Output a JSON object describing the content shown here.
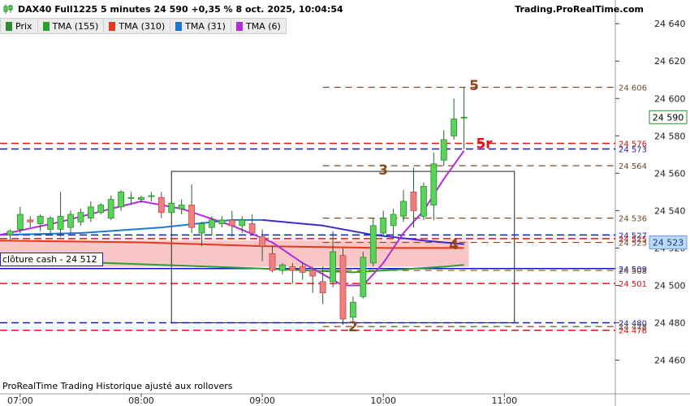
{
  "header": {
    "title": "DAX40 Full1225 5 minutes 24 590 +0,35 % 8 oct. 2025, 10:04:54",
    "site": "Trading.ProRealTime.com"
  },
  "legend": [
    {
      "label": "Prix",
      "color": "#2e8b2e"
    },
    {
      "label": "TMA (155)",
      "color": "#2ca02c"
    },
    {
      "label": "TMA (310)",
      "color": "#e03a1e"
    },
    {
      "label": "TMA (31)",
      "color": "#1f77d4"
    },
    {
      "label": "TMA (6)",
      "color": "#b22cd8"
    }
  ],
  "cash_label": "clôture cash -  24 512",
  "footer_note": "ProRealTime Trading  Historique ajusté aux rollovers",
  "colors": {
    "up": "#59d359",
    "down": "#f08080",
    "brown": "#8b4a1c",
    "red": "#e8121e",
    "blue": "#1414c8",
    "ma155": "#2ca02c",
    "ma310": "#e03a1e",
    "ma31": "#1f77d4",
    "ma6": "#b22cd8",
    "purple": "#3a2ad0",
    "band": "#f7bcbc"
  },
  "chart_data": {
    "type": "candlestick",
    "instrument": "DAX40 Full1225",
    "timeframe": "5 minutes",
    "x_ticks": [
      "07:00",
      "08:00",
      "09:00",
      "10:00",
      "11:00"
    ],
    "y_ticks": [
      "24 640",
      "24 620",
      "24 600",
      "24 580",
      "24 560",
      "24 540",
      "24 520",
      "24 500",
      "24 480",
      "24 460"
    ],
    "ylim": [
      24442,
      24644
    ],
    "xlim": [
      "06:50",
      "11:55"
    ],
    "last_price": "24 590",
    "candles": [
      {
        "t": "06:55",
        "o": 24527,
        "h": 24530,
        "l": 24524,
        "c": 24529
      },
      {
        "t": "07:00",
        "o": 24530,
        "h": 24542,
        "l": 24528,
        "c": 24538
      },
      {
        "t": "07:05",
        "o": 24535,
        "h": 24537,
        "l": 24531,
        "c": 24534
      },
      {
        "t": "07:10",
        "o": 24533,
        "h": 24538,
        "l": 24529,
        "c": 24537
      },
      {
        "t": "07:15",
        "o": 24530,
        "h": 24537,
        "l": 24527,
        "c": 24536
      },
      {
        "t": "07:20",
        "o": 24530,
        "h": 24550,
        "l": 24526,
        "c": 24537
      },
      {
        "t": "07:25",
        "o": 24531,
        "h": 24540,
        "l": 24528,
        "c": 24538
      },
      {
        "t": "07:30",
        "o": 24534,
        "h": 24541,
        "l": 24532,
        "c": 24539
      },
      {
        "t": "07:35",
        "o": 24536,
        "h": 24545,
        "l": 24534,
        "c": 24542
      },
      {
        "t": "07:40",
        "o": 24539,
        "h": 24544,
        "l": 24538,
        "c": 24543
      },
      {
        "t": "07:45",
        "o": 24536,
        "h": 24548,
        "l": 24535,
        "c": 24546
      },
      {
        "t": "07:50",
        "o": 24542,
        "h": 24551,
        "l": 24540,
        "c": 24550
      },
      {
        "t": "07:55",
        "o": 24547,
        "h": 24550,
        "l": 24543,
        "c": 24547
      },
      {
        "t": "08:00",
        "o": 24546,
        "h": 24548,
        "l": 24544,
        "c": 24547
      },
      {
        "t": "08:05",
        "o": 24548,
        "h": 24550,
        "l": 24545,
        "c": 24548
      },
      {
        "t": "08:10",
        "o": 24547,
        "h": 24550,
        "l": 24536,
        "c": 24539
      },
      {
        "t": "08:15",
        "o": 24539,
        "h": 24545,
        "l": 24538,
        "c": 24544
      },
      {
        "t": "08:20",
        "o": 24541,
        "h": 24546,
        "l": 24538,
        "c": 24543
      },
      {
        "t": "08:25",
        "o": 24543,
        "h": 24554,
        "l": 24528,
        "c": 24531
      },
      {
        "t": "08:30",
        "o": 24528,
        "h": 24534,
        "l": 24521,
        "c": 24533
      },
      {
        "t": "08:35",
        "o": 24531,
        "h": 24537,
        "l": 24527,
        "c": 24535
      },
      {
        "t": "08:40",
        "o": 24533,
        "h": 24537,
        "l": 24531,
        "c": 24535
      },
      {
        "t": "08:45",
        "o": 24535,
        "h": 24540,
        "l": 24526,
        "c": 24532
      },
      {
        "t": "08:50",
        "o": 24532,
        "h": 24537,
        "l": 24528,
        "c": 24535
      },
      {
        "t": "08:55",
        "o": 24533,
        "h": 24538,
        "l": 24529,
        "c": 24528
      },
      {
        "t": "09:00",
        "o": 24526,
        "h": 24530,
        "l": 24513,
        "c": 24521
      },
      {
        "t": "09:05",
        "o": 24517,
        "h": 24521,
        "l": 24507,
        "c": 24508
      },
      {
        "t": "09:10",
        "o": 24508,
        "h": 24512,
        "l": 24506,
        "c": 24511
      },
      {
        "t": "09:15",
        "o": 24510,
        "h": 24512,
        "l": 24501,
        "c": 24508
      },
      {
        "t": "09:20",
        "o": 24510,
        "h": 24512,
        "l": 24503,
        "c": 24507
      },
      {
        "t": "09:25",
        "o": 24508,
        "h": 24510,
        "l": 24496,
        "c": 24505
      },
      {
        "t": "09:30",
        "o": 24502,
        "h": 24510,
        "l": 24490,
        "c": 24496
      },
      {
        "t": "09:35",
        "o": 24502,
        "h": 24529,
        "l": 24499,
        "c": 24518
      },
      {
        "t": "09:40",
        "o": 24516,
        "h": 24520,
        "l": 24479,
        "c": 24482
      },
      {
        "t": "09:45",
        "o": 24483,
        "h": 24494,
        "l": 24480,
        "c": 24491
      },
      {
        "t": "09:50",
        "o": 24494,
        "h": 24518,
        "l": 24493,
        "c": 24515
      },
      {
        "t": "09:55",
        "o": 24512,
        "h": 24536,
        "l": 24510,
        "c": 24532
      },
      {
        "t": "10:00",
        "o": 24528,
        "h": 24540,
        "l": 24526,
        "c": 24536
      },
      {
        "t": "10:05",
        "o": 24532,
        "h": 24541,
        "l": 24526,
        "c": 24538
      },
      {
        "t": "10:10",
        "o": 24537,
        "h": 24551,
        "l": 24534,
        "c": 24545
      },
      {
        "t": "10:15",
        "o": 24550,
        "h": 24563,
        "l": 24531,
        "c": 24540
      },
      {
        "t": "10:20",
        "o": 24537,
        "h": 24555,
        "l": 24535,
        "c": 24553
      },
      {
        "t": "10:25",
        "o": 24543,
        "h": 24571,
        "l": 24535,
        "c": 24565
      },
      {
        "t": "10:30",
        "o": 24567,
        "h": 24583,
        "l": 24564,
        "c": 24578
      },
      {
        "t": "10:35",
        "o": 24580,
        "h": 24600,
        "l": 24578,
        "c": 24589
      },
      {
        "t": "10:40",
        "o": 24590,
        "h": 24606,
        "l": 24573,
        "c": 24590
      }
    ],
    "ma_lines": [
      {
        "name": "TMA (155)",
        "color": "#2ca02c",
        "points": [
          [
            "06:50",
            24514
          ],
          [
            "08:10",
            24511
          ],
          [
            "09:00",
            24509
          ],
          [
            "09:45",
            24507
          ],
          [
            "10:30",
            24510
          ],
          [
            "10:40",
            24511
          ]
        ]
      },
      {
        "name": "TMA (310)",
        "color": "#e03a1e",
        "points": [
          [
            "06:50",
            24524
          ],
          [
            "08:00",
            24523
          ],
          [
            "09:00",
            24521
          ],
          [
            "10:00",
            24520
          ],
          [
            "10:40",
            24520
          ]
        ]
      },
      {
        "name": "TMA (31)",
        "color": "#1f77d4",
        "points": [
          [
            "06:50",
            24527
          ],
          [
            "07:30",
            24528
          ],
          [
            "08:10",
            24531
          ],
          [
            "08:45",
            24535
          ],
          [
            "09:00",
            24535
          ]
        ]
      },
      {
        "name": "TMA (31) cont",
        "color": "#3a2ad0",
        "points": [
          [
            "09:00",
            24535
          ],
          [
            "09:30",
            24532
          ],
          [
            "09:55",
            24527
          ],
          [
            "10:20",
            24524
          ],
          [
            "10:40",
            24522
          ]
        ]
      },
      {
        "name": "TMA (6)",
        "color": "#b22cd8",
        "points": [
          [
            "06:50",
            24527
          ],
          [
            "07:20",
            24534
          ],
          [
            "07:45",
            24541
          ],
          [
            "08:00",
            24545
          ],
          [
            "08:20",
            24541
          ],
          [
            "08:45",
            24532
          ],
          [
            "09:05",
            24523
          ],
          [
            "09:20",
            24512
          ],
          [
            "09:40",
            24500
          ],
          [
            "09:50",
            24500
          ],
          [
            "10:00",
            24512
          ],
          [
            "10:10",
            24528
          ],
          [
            "10:20",
            24540
          ],
          [
            "10:30",
            24557
          ],
          [
            "10:40",
            24572
          ]
        ]
      }
    ],
    "levels": [
      {
        "value": 24606,
        "label": "24 606",
        "style": "brown",
        "from": "09:30"
      },
      {
        "value": 24576,
        "label": "24 576",
        "style": "red",
        "from": "06:50"
      },
      {
        "value": 24573,
        "label": "24 573",
        "style": "blue",
        "from": "06:50"
      },
      {
        "value": 24564,
        "label": "24 564",
        "style": "brown",
        "from": "09:30"
      },
      {
        "value": 24536,
        "label": "24 536",
        "style": "brown",
        "from": "09:30"
      },
      {
        "value": 24527,
        "label": "24 527",
        "style": "blue",
        "from": "06:50"
      },
      {
        "value": 24525,
        "label": "24 525",
        "style": "red",
        "from": "06:50"
      },
      {
        "value": 24523,
        "label": "24 523",
        "style": "brown",
        "from": "09:30"
      },
      {
        "value": 24509,
        "label": "24 509",
        "style": "solidblue",
        "from": "06:50"
      },
      {
        "value": 24508,
        "label": "24 508",
        "style": "brown",
        "from": "09:30"
      },
      {
        "value": 24501,
        "label": "24 501",
        "style": "red",
        "from": "06:50"
      },
      {
        "value": 24480,
        "label": "24 480",
        "style": "blue",
        "from": "06:50"
      },
      {
        "value": 24478,
        "label": "24 478",
        "style": "brown",
        "from": "09:30"
      },
      {
        "value": 24476,
        "label": "24 476",
        "style": "red",
        "from": "06:50"
      }
    ],
    "last_price_box": {
      "value": 24590,
      "label": "24 590"
    },
    "ma_box": {
      "value": 24523,
      "label": "24 523"
    },
    "band": {
      "from": 24510,
      "to": 24524,
      "t_start": "06:50",
      "t_end": "10:40"
    },
    "box": {
      "t_start": "08:15",
      "t_end": "11:05",
      "y_top": 24561,
      "y_bottom": 24480
    },
    "wave_labels": [
      {
        "text": "5",
        "t": "10:45",
        "y": 24607,
        "color": "#8b4a1c"
      },
      {
        "text": "5r",
        "t": "10:50",
        "y": 24576,
        "color": "#e8121e"
      },
      {
        "text": "3",
        "t": "10:00",
        "y": 24562,
        "color": "#8b4a1c"
      },
      {
        "text": "4",
        "t": "10:35",
        "y": 24522,
        "color": "#8b4a1c"
      },
      {
        "text": "2",
        "t": "09:45",
        "y": 24478,
        "color": "#8b4a1c"
      }
    ]
  }
}
